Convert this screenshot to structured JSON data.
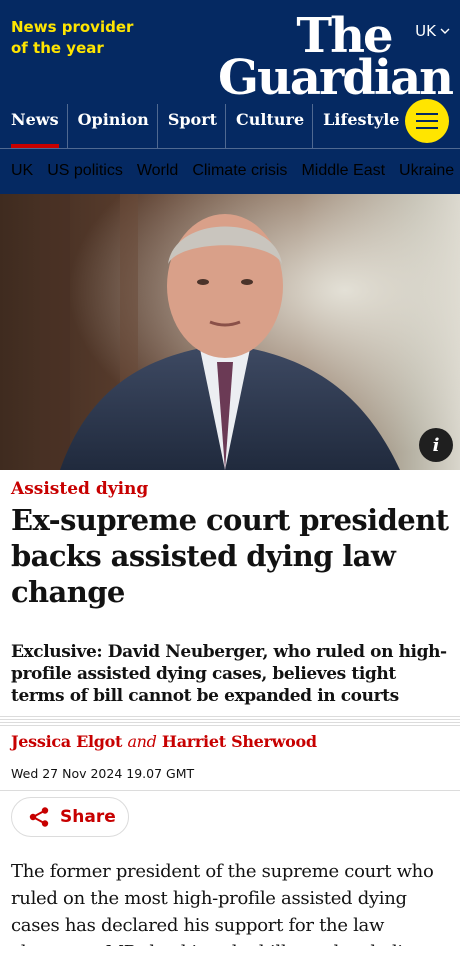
{
  "header": {
    "tagline": "News provider of the year",
    "edition": "UK",
    "logo_line1": "The",
    "logo_line2": "Guardian",
    "pillars": [
      "News",
      "Opinion",
      "Sport",
      "Culture",
      "Lifestyle"
    ],
    "active_pillar": "News",
    "menu_icon": "hamburger-menu-icon"
  },
  "subnav": {
    "items": [
      "UK",
      "US politics",
      "World",
      "Climate crisis",
      "Middle East",
      "Ukraine"
    ]
  },
  "hero": {
    "info_label": "i"
  },
  "article": {
    "kicker": "Assisted dying",
    "headline": "Ex-supreme court president backs assisted dying law change",
    "standfirst": "Exclusive: David Neuberger, who ruled on high-profile assisted dying cases, believes tight terms of bill cannot be expanded in courts",
    "byline": {
      "author1": "Jessica Elgot",
      "joiner": "and",
      "author2": "Harriet Sherwood"
    },
    "dateline": "Wed 27 Nov 2024 19.07 GMT",
    "share_label": "Share",
    "body_start": "The former president of the supreme court who ruled on the most high-profile assisted dying cases has declared his support for the law change as MPs backing the bill say they believe"
  },
  "colors": {
    "brand_blue": "#052962",
    "highlight_yellow": "#ffe500",
    "news_red": "#c70000"
  }
}
